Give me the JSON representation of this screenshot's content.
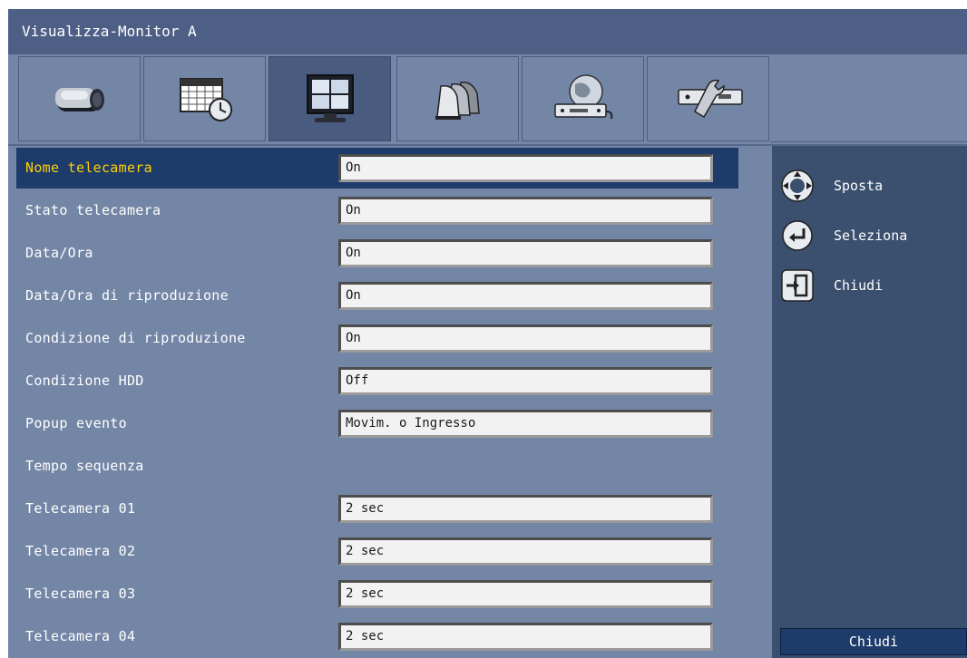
{
  "window": {
    "title": "Visualizza-Monitor A"
  },
  "tabs": [
    {
      "name": "camera",
      "icon": "camera-icon",
      "active": false
    },
    {
      "name": "schedule",
      "icon": "schedule-icon",
      "active": false
    },
    {
      "name": "display",
      "icon": "monitor-icon",
      "active": true
    },
    {
      "name": "alarms",
      "icon": "alarm-bells-icon",
      "active": false
    },
    {
      "name": "network",
      "icon": "network-icon",
      "active": false
    },
    {
      "name": "system",
      "icon": "tools-icon",
      "active": false
    }
  ],
  "settings": [
    {
      "label": "Nome telecamera",
      "value": "On",
      "selected": true
    },
    {
      "label": "Stato telecamera",
      "value": "On"
    },
    {
      "label": "Data/Ora",
      "value": "On"
    },
    {
      "label": "Data/Ora di riproduzione",
      "value": "On"
    },
    {
      "label": "Condizione di riproduzione",
      "value": "On"
    },
    {
      "label": "Condizione HDD",
      "value": "Off"
    },
    {
      "label": "Popup evento",
      "value": "Movim. o Ingresso"
    },
    {
      "label": "Tempo sequenza",
      "value": null
    },
    {
      "label": "Telecamera 01",
      "value": "2 sec"
    },
    {
      "label": "Telecamera 02",
      "value": "2 sec"
    },
    {
      "label": "Telecamera 03",
      "value": "2 sec"
    },
    {
      "label": "Telecamera 04",
      "value": "2 sec"
    }
  ],
  "side_panel": {
    "hints": [
      {
        "icon": "dpad-arrows-icon",
        "label": "Sposta"
      },
      {
        "icon": "enter-icon",
        "label": "Seleziona"
      },
      {
        "icon": "exit-door-icon",
        "label": "Chiudi"
      }
    ],
    "close_button": "Chiudi"
  },
  "colors": {
    "background": "#7486a6",
    "title_bar": "#4e5f86",
    "side_panel": "#3a506e",
    "selected_row": "#1d3b6b",
    "selected_text": "#ffd200"
  }
}
